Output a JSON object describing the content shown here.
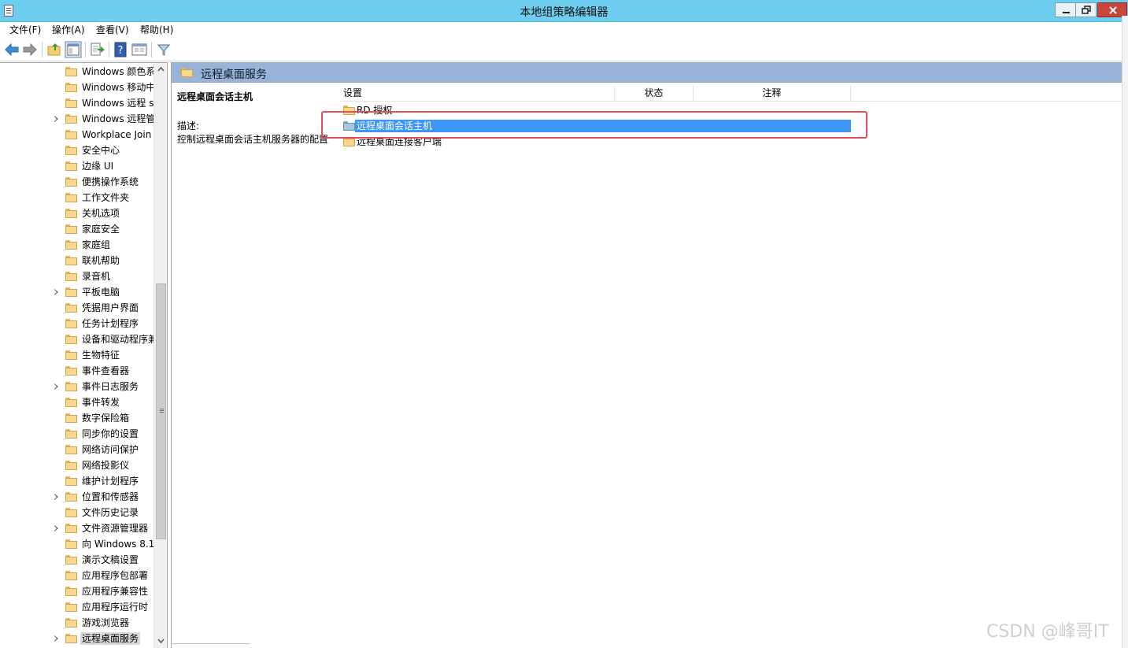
{
  "window": {
    "title": "本地组策略编辑器"
  },
  "menu": {
    "items": [
      "文件(F)",
      "操作(A)",
      "查看(V)",
      "帮助(H)"
    ]
  },
  "toolbar": {
    "icons": [
      "back-arrow-icon",
      "forward-arrow-icon",
      "up-folder-icon",
      "show-hide-tree-icon",
      "export-list-icon",
      "help-icon",
      "properties-icon",
      "filter-icon"
    ]
  },
  "tree": {
    "items": [
      {
        "label": "Windows 颜色系",
        "expandable": false
      },
      {
        "label": "Windows 移动中",
        "expandable": false
      },
      {
        "label": "Windows 远程 s",
        "expandable": false
      },
      {
        "label": "Windows 远程管",
        "expandable": true
      },
      {
        "label": "Workplace Join",
        "expandable": false
      },
      {
        "label": "安全中心",
        "expandable": false
      },
      {
        "label": "边缘 UI",
        "expandable": false
      },
      {
        "label": "便携操作系统",
        "expandable": false
      },
      {
        "label": "工作文件夹",
        "expandable": false
      },
      {
        "label": "关机选项",
        "expandable": false
      },
      {
        "label": "家庭安全",
        "expandable": false
      },
      {
        "label": "家庭组",
        "expandable": false
      },
      {
        "label": "联机帮助",
        "expandable": false
      },
      {
        "label": "录音机",
        "expandable": false
      },
      {
        "label": "平板电脑",
        "expandable": true
      },
      {
        "label": "凭据用户界面",
        "expandable": false
      },
      {
        "label": "任务计划程序",
        "expandable": false
      },
      {
        "label": "设备和驱动程序兼",
        "expandable": false
      },
      {
        "label": "生物特征",
        "expandable": false
      },
      {
        "label": "事件查看器",
        "expandable": false
      },
      {
        "label": "事件日志服务",
        "expandable": true
      },
      {
        "label": "事件转发",
        "expandable": false
      },
      {
        "label": "数字保险箱",
        "expandable": false
      },
      {
        "label": "同步你的设置",
        "expandable": false
      },
      {
        "label": "网络访问保护",
        "expandable": false
      },
      {
        "label": "网络投影仪",
        "expandable": false
      },
      {
        "label": "维护计划程序",
        "expandable": false
      },
      {
        "label": "位置和传感器",
        "expandable": true
      },
      {
        "label": "文件历史记录",
        "expandable": false
      },
      {
        "label": "文件资源管理器",
        "expandable": true
      },
      {
        "label": "向 Windows 8.1",
        "expandable": false
      },
      {
        "label": "演示文稿设置",
        "expandable": false
      },
      {
        "label": "应用程序包部署",
        "expandable": false
      },
      {
        "label": "应用程序兼容性",
        "expandable": false
      },
      {
        "label": "应用程序运行时",
        "expandable": false
      },
      {
        "label": "游戏浏览器",
        "expandable": false
      },
      {
        "label": "远程桌面服务",
        "expandable": true,
        "selected": true
      }
    ]
  },
  "right": {
    "header_title": "远程桌面服务",
    "description": {
      "title": "远程桌面会话主机",
      "label": "描述:",
      "text": "控制远程桌面会话主机服务器的配置"
    },
    "columns": {
      "setting": "设置",
      "status": "状态",
      "note": "注释"
    },
    "rows": [
      {
        "label": "RD 授权",
        "selected": false
      },
      {
        "label": "远程桌面会话主机",
        "selected": true
      },
      {
        "label": "远程桌面连接客户端",
        "selected": false
      }
    ]
  },
  "watermark": "CSDN @峰哥IT",
  "colors": {
    "titlebar": "#6dcef0",
    "header_band": "#98b3d6",
    "selection": "#3d96f5",
    "highlight_box": "#e0505e",
    "folder": "#f8d98e"
  }
}
